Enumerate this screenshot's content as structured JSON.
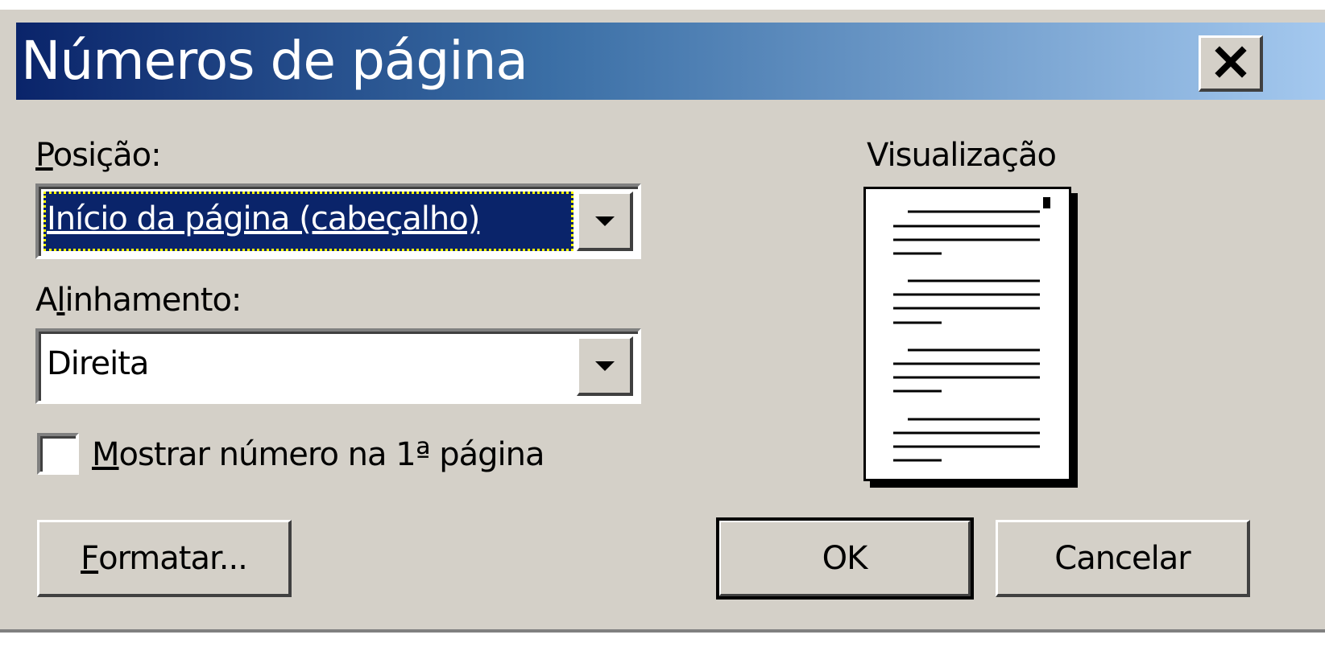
{
  "window": {
    "title": "Números de página",
    "close_symbol": "✕"
  },
  "position": {
    "label": "Posição:",
    "label_accel": "P",
    "label_rest": "osição:",
    "selected": "Início da página (cabeçalho)"
  },
  "alignment": {
    "label": "Alinhamento:",
    "label_pre": "A",
    "label_accel": "l",
    "label_rest": "inhamento:",
    "selected": "Direita"
  },
  "first_page_checkbox": {
    "label": "Mostrar número na 1ª página",
    "label_accel": "M",
    "label_rest": "ostrar número na 1ª página",
    "checked": false
  },
  "preview": {
    "label": "Visualização"
  },
  "buttons": {
    "format": {
      "label": "Formatar...",
      "accel": "F",
      "rest": "ormatar..."
    },
    "ok": {
      "label": "OK"
    },
    "cancel": {
      "label": "Cancelar"
    }
  },
  "icons": {
    "dropdown": "chevron-down-icon",
    "close": "close-icon"
  },
  "colors": {
    "title_gradient_start": "#0a246a",
    "title_gradient_end": "#a6caf0",
    "dialog_face": "#d4d0c8",
    "selection": "#0a246a"
  }
}
